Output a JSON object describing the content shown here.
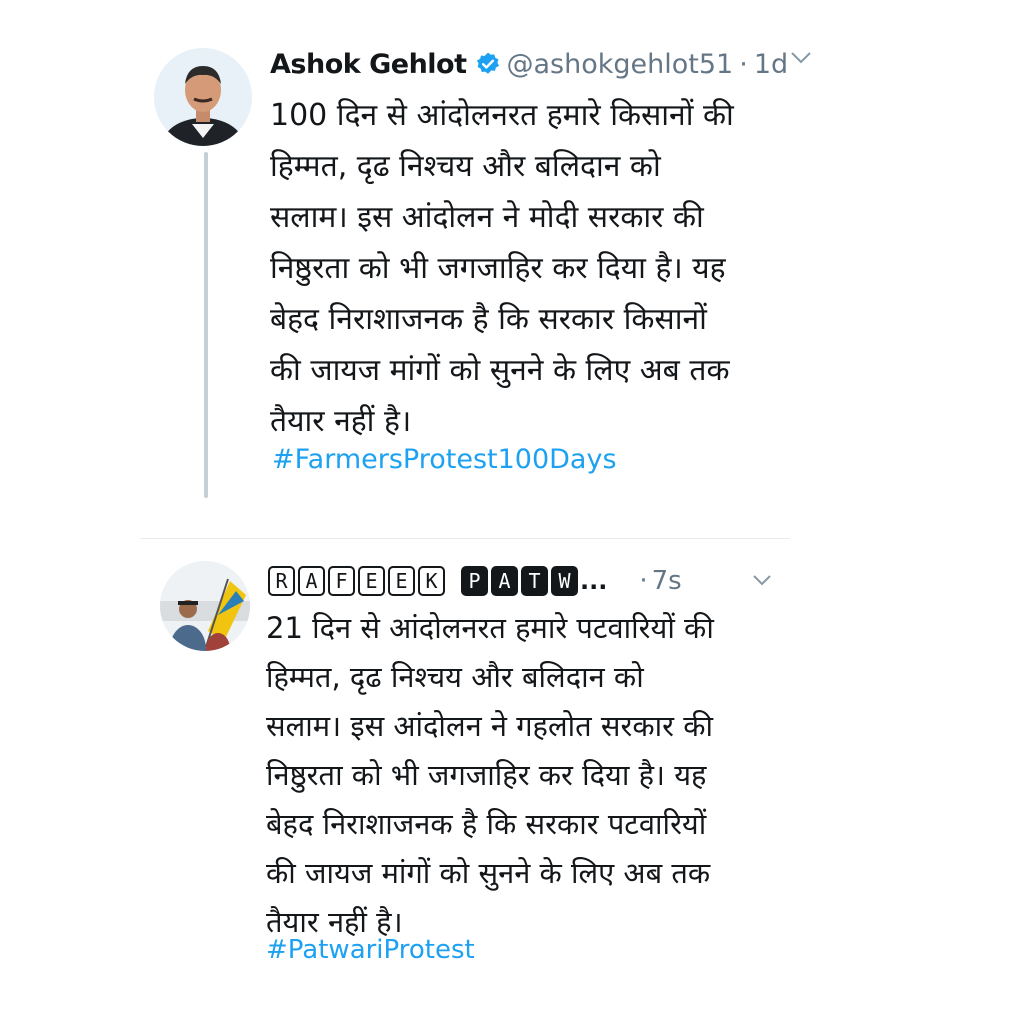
{
  "tweet1": {
    "author_name": "Ashok Gehlot",
    "handle": "@ashokgehlot51",
    "separator": "·",
    "time": "1d",
    "body": "100 दिन से आंदोलनरत हमारे किसानों की\nहिम्मत, दृढ निश्चय और बलिदान को\nसलाम। इस आंदोलन ने मोदी सरकार की\nनिष्ठुरता को भी जगजाहिर कर दिया है। यह\nबेहद निराशाजनक है कि सरकार किसानों\nकी जायज मांगों को सुनने के लिए अब तक\nतैयार नहीं है।",
    "hashtag": "#FarmersProtest100Days",
    "verified_color": "#1da1f2",
    "avatar_icon": "person-photo-icon",
    "menu_icon": "chevron-down-icon"
  },
  "tweet2": {
    "author_name_letters": [
      "R",
      "A",
      "F",
      "E",
      "E",
      "K",
      " ",
      "P",
      "A",
      "T",
      "W"
    ],
    "author_name_suffix": "...",
    "separator": "·",
    "time": "7s",
    "body": "21 दिन से आंदोलनरत हमारे पटवारियों की\nहिम्मत, दृढ निश्चय और बलिदान को\nसलाम। इस आंदोलन ने गहलोत सरकार की\nनिष्ठुरता को भी जगजाहिर कर दिया है। यह\nबेहद निराशाजनक है कि सरकार पटवारियों\nकी जायज मांगों को सुनने के लिए अब तक\nतैयार नहीं है।",
    "hashtag": "#PatwariProtest",
    "avatar_icon": "person-photo-icon",
    "menu_icon": "chevron-down-icon"
  },
  "colors": {
    "text": "#14171a",
    "secondary": "#657786",
    "link": "#1da1f2",
    "divider": "#e6ecf0"
  }
}
